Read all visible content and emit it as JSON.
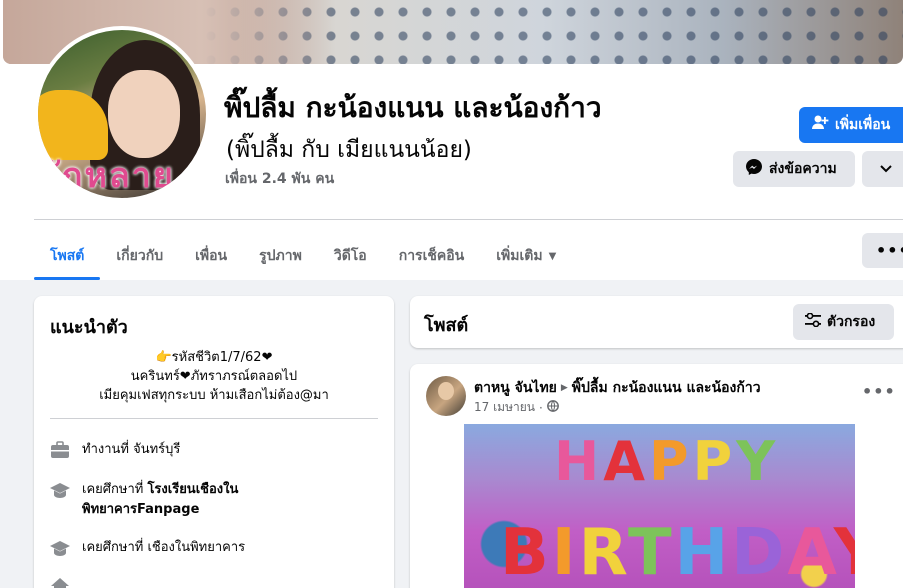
{
  "profile": {
    "name": "พิ๊ปลื้ม กะน้องแนน และน้องก้าว",
    "alt_name": "(พิ๊ปลื้ม กับ เมียแนนน้อย)",
    "friends": "เพื่อน 2.4 พัน คน",
    "avatar_caption": "จักหลาย"
  },
  "actions": {
    "add_friend": "เพิ่มเพื่อน",
    "message": "ส่งข้อความ"
  },
  "tabs": [
    {
      "label": "โพสต์"
    },
    {
      "label": "เกี่ยวกับ"
    },
    {
      "label": "เพื่อน"
    },
    {
      "label": "รูปภาพ"
    },
    {
      "label": "วิดีโอ"
    },
    {
      "label": "การเช็คอิน"
    },
    {
      "label": "เพิ่มเติม"
    }
  ],
  "intro": {
    "title": "แนะนำตัว",
    "bio_lines": [
      "👉รหัสชีวิต1/7/62❤",
      "นครินทร์❤ภัทราภรณ์ตลอดไป",
      "เมียคุมเฟสทุกระบบ ห้ามเสือกไม่ต้อง@มา"
    ],
    "work_prefix": "ทำงานที่ ",
    "work_place": "จันทร์บุรี",
    "study1_prefix": "เคยศึกษาที่ ",
    "study1_place_line1": "โรงเรียนเชืองใน",
    "study1_place_line2": "พิทยาคารFanpage",
    "study2_prefix": "เคยศึกษาที่ ",
    "study2_place": "เชืองในพิทยาคาร"
  },
  "posts": {
    "title": "โพสต์",
    "filter_label": "ตัวกรอง"
  },
  "post": {
    "author": "ตาหนู จันไทย",
    "target": "พิ๊ปลื้ม กะน้องแนน และน้องก้าว",
    "date": "17 เมษายน",
    "image_line1": "HAPPY",
    "image_line2": "BIRTHDAY"
  },
  "icons": {
    "add_friend": "person-plus-icon",
    "message": "messenger-icon",
    "more": "chevron-down-icon",
    "tab_more": "ellipsis-icon",
    "work": "briefcase-icon",
    "study": "graduation-cap-icon",
    "filter": "sliders-icon",
    "audience": "globe-icon",
    "post_more": "ellipsis-icon"
  },
  "colors": {
    "accent": "#1877f2",
    "muted": "#65676b",
    "button_gray": "#e4e6eb",
    "background": "#f0f2f5"
  }
}
